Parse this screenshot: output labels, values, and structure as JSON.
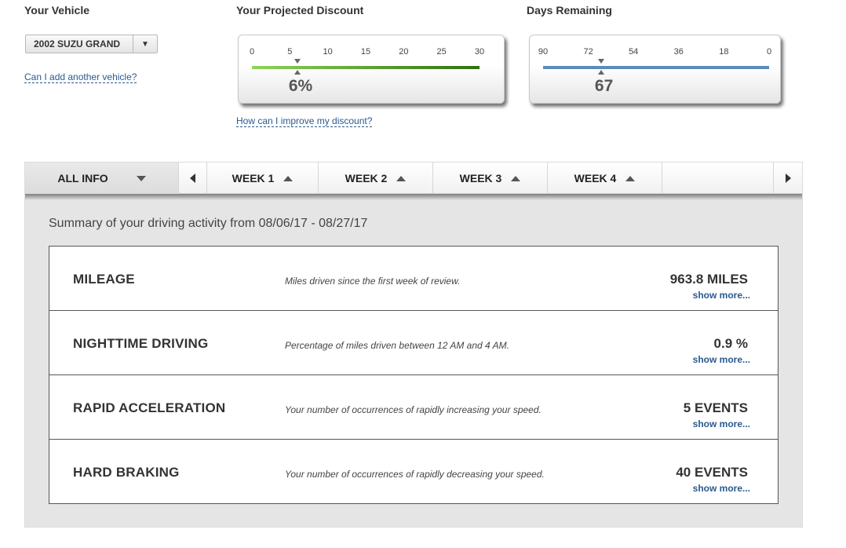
{
  "vehicle": {
    "heading": "Your Vehicle",
    "selected": "2002 SUZU GRAND",
    "dropdown_glyph": "▼",
    "add_link": "Can I add another vehicle?"
  },
  "discount": {
    "heading": "Your Projected Discount",
    "ticks": [
      "0",
      "5",
      "10",
      "15",
      "20",
      "25",
      "30"
    ],
    "value": 6,
    "value_label": "6%",
    "improve_link": "How can I improve my discount?",
    "colors": {
      "bar_start": "#8fd45a",
      "bar_end": "#2f7012"
    }
  },
  "days": {
    "heading": "Days Remaining",
    "ticks": [
      "90",
      "72",
      "54",
      "36",
      "18",
      "0"
    ],
    "value": 67,
    "value_label": "67",
    "colors": {
      "bar": "#5b8bbd"
    }
  },
  "tabs": {
    "all_info": "ALL INFO",
    "weeks": [
      "WEEK 1",
      "WEEK 2",
      "WEEK 3",
      "WEEK 4"
    ],
    "prev_icon": "triangle-left-icon",
    "next_icon": "triangle-right-icon"
  },
  "summary": "Summary of your driving activity from 08/06/17 - 08/27/17",
  "stats": [
    {
      "name": "MILEAGE",
      "desc": "Miles driven since the first week of review.",
      "value": "963.8 MILES",
      "more": "show more..."
    },
    {
      "name": "NIGHTTIME DRIVING",
      "desc": "Percentage of miles driven between 12 AM and 4 AM.",
      "value": "0.9 %",
      "more": "show more..."
    },
    {
      "name": "RAPID ACCELERATION",
      "desc": "Your number of occurrences of rapidly increasing your speed.",
      "value": "5 EVENTS",
      "more": "show more..."
    },
    {
      "name": "HARD BRAKING",
      "desc": "Your number of occurrences of rapidly decreasing your speed.",
      "value": "40 EVENTS",
      "more": "show more..."
    }
  ]
}
